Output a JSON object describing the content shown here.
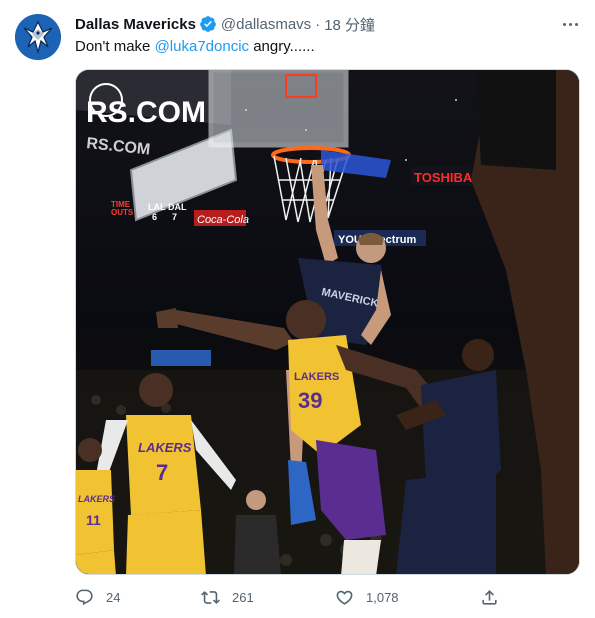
{
  "tweet": {
    "author_name": "Dallas Mavericks",
    "handle": "@dallasmavs",
    "separator": "·",
    "time": "18 分鐘",
    "text_prefix": "Don't make ",
    "mention": "@luka7doncic",
    "text_suffix": " angry......",
    "verified": true
  },
  "media": {
    "banner_text": "RS.COM",
    "banner_sub": "RS.COM",
    "sign_toshiba": "TOSHIBA",
    "sign_spectrum": "YOUR  pectrum",
    "sign_cocacola": "Coca-Cola",
    "scoreboard_time": "TIME\nOUTS",
    "scoreboard_lal": "LAL",
    "scoreboard_dal": "DAL",
    "scoreboard_lal_val": "6",
    "scoreboard_dal_val": "7",
    "jersey_doncic": "MAVERICKS",
    "jersey_lakers_7": "LAKERS",
    "jersey_lakers_7_num": "7",
    "jersey_lakers_11": "LAKERS",
    "jersey_lakers_11_num": "11",
    "jersey_howard": "LAKERS",
    "jersey_howard_num": "39"
  },
  "actions": {
    "reply_count": "24",
    "retweet_count": "261",
    "like_count": "1,078"
  },
  "colors": {
    "accent": "#1d9bf0",
    "secondary_text": "#536471",
    "lakers_gold": "#f1c232",
    "lakers_purple": "#5c2d91",
    "mavs_navy": "#1b2340"
  },
  "icons": [
    "more-icon",
    "verified-icon",
    "reply-icon",
    "retweet-icon",
    "like-icon",
    "share-icon"
  ]
}
